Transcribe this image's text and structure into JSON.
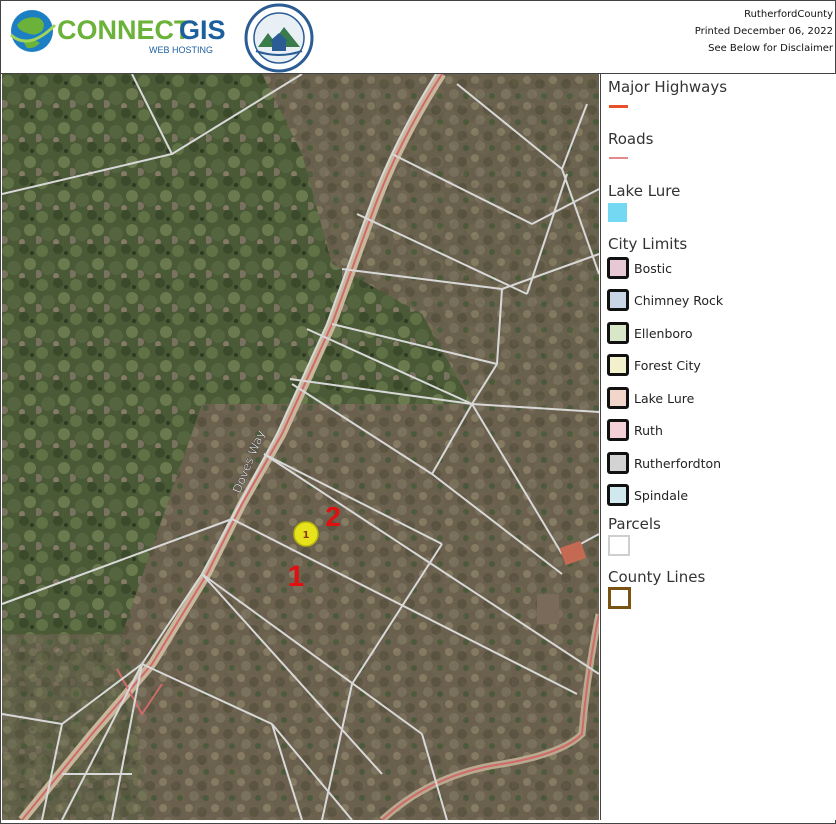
{
  "header": {
    "logo_brand_main": "CONNECT",
    "logo_brand_accent": "GIS",
    "logo_tagline": "WEB HOSTING",
    "print_line1": "RutherfordCounty",
    "print_line2": "Printed December 06, 2022",
    "print_line3": "See Below for Disclaimer"
  },
  "map": {
    "road_label": "Doves Way",
    "marker_label": "1",
    "annotations": [
      "1",
      "2"
    ],
    "colors": {
      "parcel": "#d8d8d8",
      "road": "#d06a6a",
      "annotation": "#e01010",
      "marker": "#e6e21c"
    }
  },
  "legend": {
    "major_highways": {
      "label": "Major Highways",
      "color": "#e8502a"
    },
    "roads": {
      "label": "Roads",
      "color": "#e48a8a"
    },
    "lake_lure": {
      "label": "Lake Lure",
      "color": "#74d8f2"
    },
    "city_limits": {
      "label": "City Limits",
      "items": [
        {
          "label": "Bostic",
          "fill": "#e7c9d6"
        },
        {
          "label": "Chimney Rock",
          "fill": "#c9d6e6"
        },
        {
          "label": "Ellenboro",
          "fill": "#d9e7c9"
        },
        {
          "label": "Forest City",
          "fill": "#f3f1cc"
        },
        {
          "label": "Lake Lure",
          "fill": "#f1d6c9"
        },
        {
          "label": "Ruth",
          "fill": "#f3cfd8"
        },
        {
          "label": "Rutherfordton",
          "fill": "#d3d3d3"
        },
        {
          "label": "Spindale",
          "fill": "#cfe9ee"
        }
      ]
    },
    "parcels": {
      "label": "Parcels",
      "color": "#cfcfcf"
    },
    "county_lines": {
      "label": "County Lines",
      "color": "#7a5212"
    }
  }
}
